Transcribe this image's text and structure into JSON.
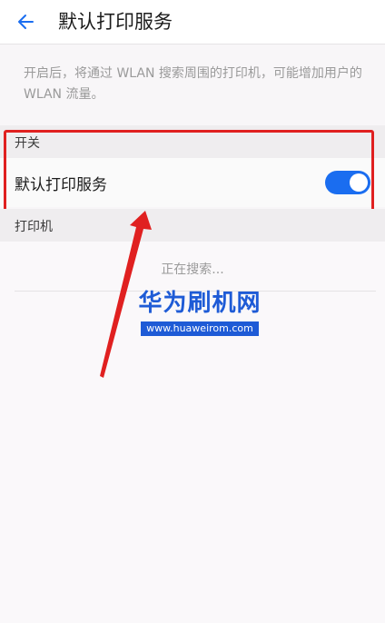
{
  "app_bar": {
    "back_icon": "arrow-left-icon",
    "title": "默认打印服务"
  },
  "description": "开启后，将通过 WLAN 搜索周围的打印机，可能增加用户的 WLAN 流量。",
  "switch_section": {
    "header": "开关",
    "label": "默认打印服务",
    "enabled": true
  },
  "printer_section": {
    "header": "打印机",
    "status": "正在搜索..."
  },
  "watermark": {
    "title": "华为刷机网",
    "url": "www.huaweirom.com"
  },
  "colors": {
    "accent": "#1a6df0",
    "annotation": "#e02020",
    "watermark": "#1e5bd6"
  }
}
